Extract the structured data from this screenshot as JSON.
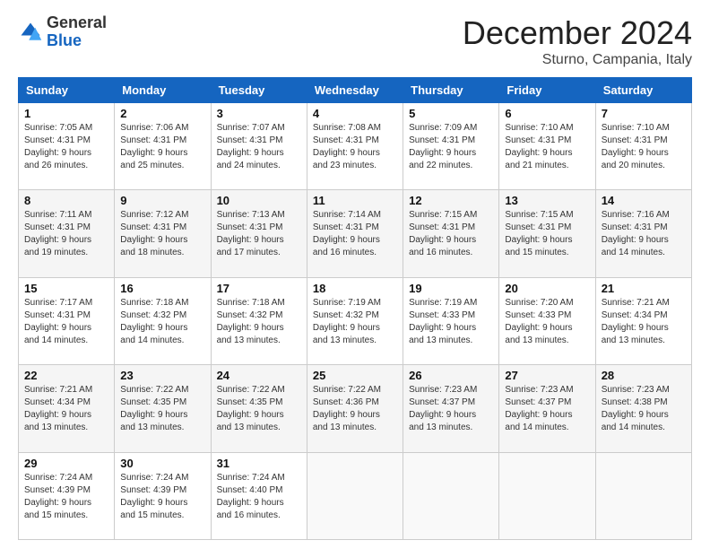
{
  "header": {
    "logo_general": "General",
    "logo_blue": "Blue",
    "month_title": "December 2024",
    "location": "Sturno, Campania, Italy"
  },
  "days_of_week": [
    "Sunday",
    "Monday",
    "Tuesday",
    "Wednesday",
    "Thursday",
    "Friday",
    "Saturday"
  ],
  "weeks": [
    [
      {
        "day": "1",
        "sunrise": "7:05 AM",
        "sunset": "4:31 PM",
        "daylight": "9 hours and 26 minutes."
      },
      {
        "day": "2",
        "sunrise": "7:06 AM",
        "sunset": "4:31 PM",
        "daylight": "9 hours and 25 minutes."
      },
      {
        "day": "3",
        "sunrise": "7:07 AM",
        "sunset": "4:31 PM",
        "daylight": "9 hours and 24 minutes."
      },
      {
        "day": "4",
        "sunrise": "7:08 AM",
        "sunset": "4:31 PM",
        "daylight": "9 hours and 23 minutes."
      },
      {
        "day": "5",
        "sunrise": "7:09 AM",
        "sunset": "4:31 PM",
        "daylight": "9 hours and 22 minutes."
      },
      {
        "day": "6",
        "sunrise": "7:10 AM",
        "sunset": "4:31 PM",
        "daylight": "9 hours and 21 minutes."
      },
      {
        "day": "7",
        "sunrise": "7:10 AM",
        "sunset": "4:31 PM",
        "daylight": "9 hours and 20 minutes."
      }
    ],
    [
      {
        "day": "8",
        "sunrise": "7:11 AM",
        "sunset": "4:31 PM",
        "daylight": "9 hours and 19 minutes."
      },
      {
        "day": "9",
        "sunrise": "7:12 AM",
        "sunset": "4:31 PM",
        "daylight": "9 hours and 18 minutes."
      },
      {
        "day": "10",
        "sunrise": "7:13 AM",
        "sunset": "4:31 PM",
        "daylight": "9 hours and 17 minutes."
      },
      {
        "day": "11",
        "sunrise": "7:14 AM",
        "sunset": "4:31 PM",
        "daylight": "9 hours and 16 minutes."
      },
      {
        "day": "12",
        "sunrise": "7:15 AM",
        "sunset": "4:31 PM",
        "daylight": "9 hours and 16 minutes."
      },
      {
        "day": "13",
        "sunrise": "7:15 AM",
        "sunset": "4:31 PM",
        "daylight": "9 hours and 15 minutes."
      },
      {
        "day": "14",
        "sunrise": "7:16 AM",
        "sunset": "4:31 PM",
        "daylight": "9 hours and 14 minutes."
      }
    ],
    [
      {
        "day": "15",
        "sunrise": "7:17 AM",
        "sunset": "4:31 PM",
        "daylight": "9 hours and 14 minutes."
      },
      {
        "day": "16",
        "sunrise": "7:18 AM",
        "sunset": "4:32 PM",
        "daylight": "9 hours and 14 minutes."
      },
      {
        "day": "17",
        "sunrise": "7:18 AM",
        "sunset": "4:32 PM",
        "daylight": "9 hours and 13 minutes."
      },
      {
        "day": "18",
        "sunrise": "7:19 AM",
        "sunset": "4:32 PM",
        "daylight": "9 hours and 13 minutes."
      },
      {
        "day": "19",
        "sunrise": "7:19 AM",
        "sunset": "4:33 PM",
        "daylight": "9 hours and 13 minutes."
      },
      {
        "day": "20",
        "sunrise": "7:20 AM",
        "sunset": "4:33 PM",
        "daylight": "9 hours and 13 minutes."
      },
      {
        "day": "21",
        "sunrise": "7:21 AM",
        "sunset": "4:34 PM",
        "daylight": "9 hours and 13 minutes."
      }
    ],
    [
      {
        "day": "22",
        "sunrise": "7:21 AM",
        "sunset": "4:34 PM",
        "daylight": "9 hours and 13 minutes."
      },
      {
        "day": "23",
        "sunrise": "7:22 AM",
        "sunset": "4:35 PM",
        "daylight": "9 hours and 13 minutes."
      },
      {
        "day": "24",
        "sunrise": "7:22 AM",
        "sunset": "4:35 PM",
        "daylight": "9 hours and 13 minutes."
      },
      {
        "day": "25",
        "sunrise": "7:22 AM",
        "sunset": "4:36 PM",
        "daylight": "9 hours and 13 minutes."
      },
      {
        "day": "26",
        "sunrise": "7:23 AM",
        "sunset": "4:37 PM",
        "daylight": "9 hours and 13 minutes."
      },
      {
        "day": "27",
        "sunrise": "7:23 AM",
        "sunset": "4:37 PM",
        "daylight": "9 hours and 14 minutes."
      },
      {
        "day": "28",
        "sunrise": "7:23 AM",
        "sunset": "4:38 PM",
        "daylight": "9 hours and 14 minutes."
      }
    ],
    [
      {
        "day": "29",
        "sunrise": "7:24 AM",
        "sunset": "4:39 PM",
        "daylight": "9 hours and 15 minutes."
      },
      {
        "day": "30",
        "sunrise": "7:24 AM",
        "sunset": "4:39 PM",
        "daylight": "9 hours and 15 minutes."
      },
      {
        "day": "31",
        "sunrise": "7:24 AM",
        "sunset": "4:40 PM",
        "daylight": "9 hours and 16 minutes."
      },
      null,
      null,
      null,
      null
    ]
  ],
  "labels": {
    "sunrise": "Sunrise: ",
    "sunset": "Sunset: ",
    "daylight": "Daylight hours"
  }
}
